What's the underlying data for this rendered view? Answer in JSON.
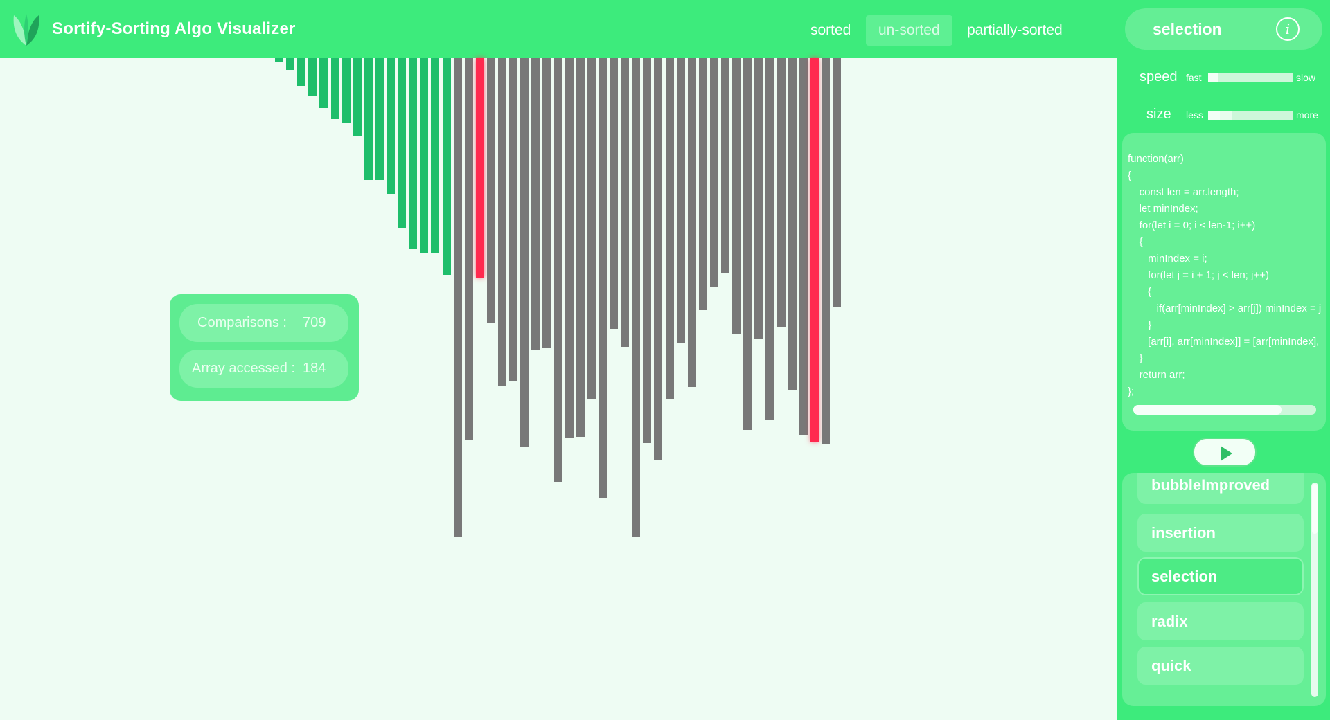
{
  "header": {
    "title": "Sortify-Sorting Algo Visualizer",
    "modes": [
      "sorted",
      "un-sorted",
      "partially-sorted"
    ],
    "active_mode": "un-sorted"
  },
  "stats": {
    "comparisons_label": "Comparisons   :",
    "comparisons_value": "709",
    "array_accessed_label": "Array accessed :",
    "array_accessed_value": "184"
  },
  "sidebar": {
    "current_algorithm": "selection",
    "speed": {
      "label": "speed",
      "low_label": "fast",
      "high_label": "slow",
      "value_fraction": 0.12
    },
    "size": {
      "label": "size",
      "low_label": "less",
      "high_label": "more",
      "value_fraction": 0.25
    },
    "code": "function(arr)\n{\n    const len = arr.length;\n    let minIndex;\n    for(let i = 0; i < len-1; i++)\n    {\n       minIndex = i;\n       for(let j = i + 1; j < len; j++)\n       {\n          if(arr[minIndex] > arr[j]) minIndex = j;\n       }\n       [arr[i], arr[minIndex]] = [arr[minIndex], arr[i]];\n    }\n    return arr;\n};",
    "algorithms": [
      "bubbleImproved",
      "insertion",
      "selection",
      "radix",
      "quick"
    ]
  },
  "colors": {
    "sorted": "#1ebe6b",
    "unsorted": "#787878",
    "compare": "#ff2a4f"
  },
  "chart_data": {
    "type": "bar",
    "values": [
      5,
      17,
      40,
      54,
      72,
      88,
      94,
      112,
      176,
      176,
      196,
      246,
      275,
      281,
      281,
      313,
      692,
      551,
      314,
      382,
      474,
      466,
      562,
      422,
      418,
      612,
      549,
      547,
      493,
      635,
      391,
      417,
      692,
      556,
      581,
      492,
      412,
      475,
      364,
      331,
      311,
      398,
      537,
      405,
      522,
      389,
      479,
      544,
      642,
      558,
      359
    ]
  }
}
